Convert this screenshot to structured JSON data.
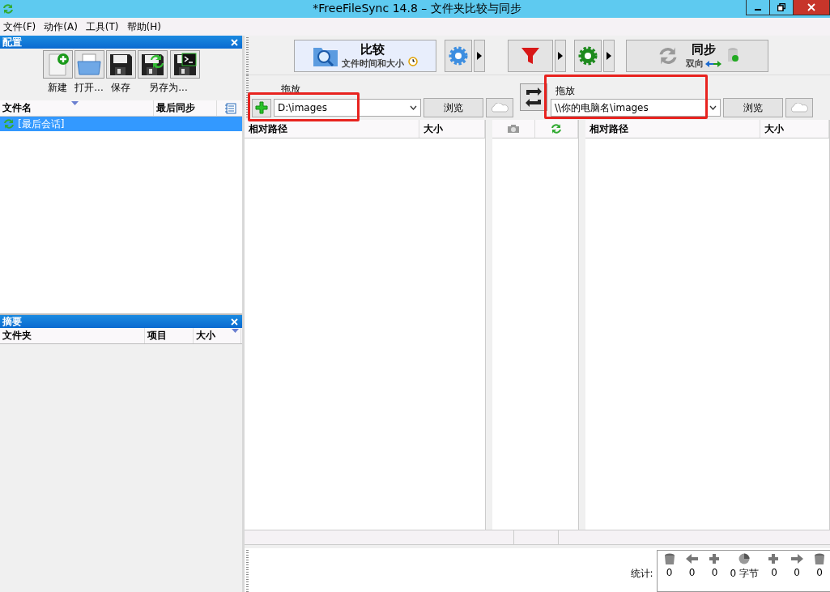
{
  "window": {
    "title": "*FreeFileSync 14.8 – 文件夹比较与同步"
  },
  "menu": [
    {
      "label": "文件(F)"
    },
    {
      "label": "动作(A)"
    },
    {
      "label": "工具(T)"
    },
    {
      "label": "帮助(H)"
    }
  ],
  "config_panel": {
    "title": "配置",
    "toolbar": [
      {
        "label": "新建",
        "buttons": [
          {
            "kind": "new"
          }
        ]
      },
      {
        "label": "打开...",
        "buttons": [
          {
            "kind": "open"
          }
        ]
      },
      {
        "label": "保存",
        "buttons": [
          {
            "kind": "save"
          }
        ]
      },
      {
        "label": "另存为...",
        "buttons": [
          {
            "kind": "save_as"
          },
          {
            "kind": "save_batch"
          }
        ]
      }
    ],
    "columns": [
      "文件名",
      "最后同步"
    ],
    "sessions": [
      {
        "name": "[最后会话]",
        "selected": true
      }
    ]
  },
  "summary_panel": {
    "title": "摘要",
    "columns": [
      "文件夹",
      "项目",
      "大小"
    ]
  },
  "compare": {
    "label": "比较",
    "variant": "文件时间和大小"
  },
  "sync": {
    "label": "同步",
    "variant": "双向"
  },
  "left_folder": {
    "label": "拖放",
    "path": "D:\\images",
    "browse": "浏览",
    "highlighted": true
  },
  "right_folder": {
    "label": "拖放",
    "path": "\\\\你的电脑名\\images",
    "browse": "浏览",
    "highlighted": true
  },
  "left_grid": {
    "columns": [
      "相对路径",
      "大小"
    ]
  },
  "right_grid": {
    "columns": [
      "相对路径",
      "大小"
    ]
  },
  "stats": {
    "label": "统计:",
    "items": [
      {
        "kind": "delete_left",
        "value": "0"
      },
      {
        "kind": "update_left",
        "value": "0"
      },
      {
        "kind": "create_left",
        "value": "0"
      },
      {
        "kind": "bytes",
        "value": "0 字节"
      },
      {
        "kind": "create_right",
        "value": "0"
      },
      {
        "kind": "update_right",
        "value": "0"
      },
      {
        "kind": "delete_right",
        "value": "0"
      }
    ]
  }
}
